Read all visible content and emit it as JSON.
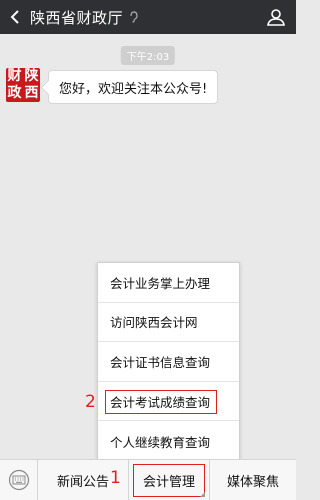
{
  "header": {
    "title": "陕西省财政厅",
    "back_icon": "chevron-left-icon",
    "speaker_icon": "ear-icon",
    "profile_icon": "person-icon"
  },
  "chat": {
    "timestamp": "下午2:03",
    "avatar_chars": [
      "财",
      "陕",
      "政",
      "西"
    ],
    "message": "您好，欢迎关注本公众号!"
  },
  "popup_menu": {
    "items": [
      "会计业务掌上办理",
      "访问陕西会计网",
      "会计证书信息查询",
      "会计考试成绩查询",
      "个人继续教育查询"
    ],
    "annotation": "2"
  },
  "bottom_menu": {
    "keyboard_icon": "keyboard-icon",
    "tabs": [
      "新闻公告",
      "会计管理",
      "媒体聚焦"
    ],
    "annotation": "1"
  },
  "colors": {
    "header_bg": "#2f3033",
    "brand_red": "#c9181e",
    "annotation_red": "#e0201a"
  }
}
